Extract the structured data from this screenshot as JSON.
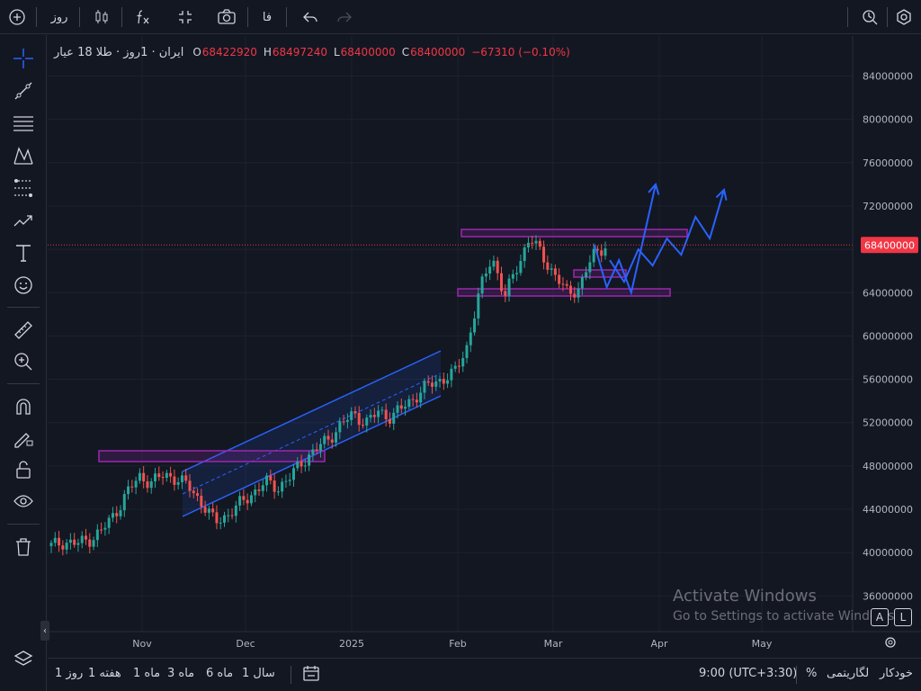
{
  "toolbar": {
    "interval": "روز",
    "language": "فا",
    "icons": [
      "plus-circle-icon",
      "candles-icon",
      "fx-icon",
      "compare-icon",
      "camera-icon",
      "undo-icon",
      "redo-icon",
      "alert-icon",
      "settings-icon"
    ]
  },
  "legend": {
    "symbol": "ایران · 1روز · طلا 18 عیار",
    "o_label": "O",
    "o_value": "68422920",
    "h_label": "H",
    "h_value": "68497240",
    "l_label": "L",
    "l_value": "68400000",
    "c_label": "C",
    "c_value": "68400000",
    "change": "−67310 (−0.10%)"
  },
  "left_tools": [
    "crosshair-icon",
    "trendline-icon",
    "fib-icon",
    "pattern-icon",
    "gann-icon",
    "prediction-icon",
    "text-icon",
    "emoji-icon",
    "ruler-icon",
    "zoom-icon",
    "magnet-icon",
    "lock-draw-icon",
    "lock-icon",
    "eye-icon",
    "trash-icon",
    "layers-icon"
  ],
  "price_axis": {
    "labels": [
      "84000000",
      "80000000",
      "76000000",
      "72000000",
      "68000000",
      "64000000",
      "60000000",
      "56000000",
      "52000000",
      "48000000",
      "44000000",
      "40000000",
      "36000000"
    ],
    "current_price": "68400000"
  },
  "time_axis": {
    "labels": [
      "Nov",
      "Dec",
      "2025",
      "Feb",
      "Mar",
      "Apr",
      "May"
    ]
  },
  "chart_data": {
    "type": "candlestick",
    "title": "ایران · 1روز · طلا 18 عیار",
    "ylim": [
      32700000,
      87700000
    ],
    "last_price": 68400000,
    "x_labels": [
      "Nov",
      "Dec",
      "2025",
      "Feb",
      "Mar",
      "Apr",
      "May"
    ],
    "approx_closes": [
      40600000,
      41000000,
      40800000,
      41200000,
      42000000,
      43500000,
      45500000,
      47000000,
      46500000,
      47200000,
      46800000,
      46000000,
      44500000,
      42800000,
      43500000,
      44500000,
      45500000,
      46500000,
      46000000,
      47000000,
      48500000,
      49500000,
      50500000,
      51800000,
      52800000,
      52000000,
      53000000,
      52500000,
      53500000,
      54500000,
      55500000,
      56000000,
      56500000,
      59000000,
      64000000,
      67500000,
      63500000,
      66500000,
      69000000,
      67500000,
      65500000,
      64000000,
      64500000,
      67500000,
      68400000
    ],
    "annotations": {
      "projection_path_1": [
        68400000,
        64500000,
        67000000,
        64000000,
        69000000,
        74000000
      ],
      "projection_path_2": [
        67000000,
        65000000,
        68000000,
        66500000,
        69000000,
        67500000,
        71000000,
        69000000,
        73500000
      ]
    }
  },
  "bottom": {
    "ranges": [
      "1 روز",
      "1 هفته",
      "1 ماه",
      "3 ماه",
      "6 ماه",
      "1 سال"
    ],
    "time": "9:00 (UTC+3:30)",
    "percent": "%",
    "log": "لگاریتمی",
    "auto": "خودکار"
  },
  "watermark": {
    "title": "Activate Windows",
    "subtitle": "Go to Settings to activate Windows."
  },
  "colors": {
    "background": "#131722",
    "up": "#26a69a",
    "down": "#ef5350",
    "channel": "#2962ff",
    "zone": "#9c27b0",
    "price_tag": "#f23645"
  }
}
